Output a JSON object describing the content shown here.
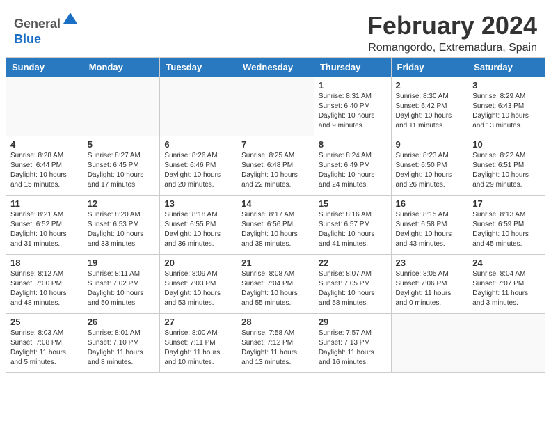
{
  "header": {
    "logo_general": "General",
    "logo_blue": "Blue",
    "month_title": "February 2024",
    "location": "Romangordo, Extremadura, Spain"
  },
  "weekdays": [
    "Sunday",
    "Monday",
    "Tuesday",
    "Wednesday",
    "Thursday",
    "Friday",
    "Saturday"
  ],
  "weeks": [
    [
      {
        "day": "",
        "info": ""
      },
      {
        "day": "",
        "info": ""
      },
      {
        "day": "",
        "info": ""
      },
      {
        "day": "",
        "info": ""
      },
      {
        "day": "1",
        "info": "Sunrise: 8:31 AM\nSunset: 6:40 PM\nDaylight: 10 hours\nand 9 minutes."
      },
      {
        "day": "2",
        "info": "Sunrise: 8:30 AM\nSunset: 6:42 PM\nDaylight: 10 hours\nand 11 minutes."
      },
      {
        "day": "3",
        "info": "Sunrise: 8:29 AM\nSunset: 6:43 PM\nDaylight: 10 hours\nand 13 minutes."
      }
    ],
    [
      {
        "day": "4",
        "info": "Sunrise: 8:28 AM\nSunset: 6:44 PM\nDaylight: 10 hours\nand 15 minutes."
      },
      {
        "day": "5",
        "info": "Sunrise: 8:27 AM\nSunset: 6:45 PM\nDaylight: 10 hours\nand 17 minutes."
      },
      {
        "day": "6",
        "info": "Sunrise: 8:26 AM\nSunset: 6:46 PM\nDaylight: 10 hours\nand 20 minutes."
      },
      {
        "day": "7",
        "info": "Sunrise: 8:25 AM\nSunset: 6:48 PM\nDaylight: 10 hours\nand 22 minutes."
      },
      {
        "day": "8",
        "info": "Sunrise: 8:24 AM\nSunset: 6:49 PM\nDaylight: 10 hours\nand 24 minutes."
      },
      {
        "day": "9",
        "info": "Sunrise: 8:23 AM\nSunset: 6:50 PM\nDaylight: 10 hours\nand 26 minutes."
      },
      {
        "day": "10",
        "info": "Sunrise: 8:22 AM\nSunset: 6:51 PM\nDaylight: 10 hours\nand 29 minutes."
      }
    ],
    [
      {
        "day": "11",
        "info": "Sunrise: 8:21 AM\nSunset: 6:52 PM\nDaylight: 10 hours\nand 31 minutes."
      },
      {
        "day": "12",
        "info": "Sunrise: 8:20 AM\nSunset: 6:53 PM\nDaylight: 10 hours\nand 33 minutes."
      },
      {
        "day": "13",
        "info": "Sunrise: 8:18 AM\nSunset: 6:55 PM\nDaylight: 10 hours\nand 36 minutes."
      },
      {
        "day": "14",
        "info": "Sunrise: 8:17 AM\nSunset: 6:56 PM\nDaylight: 10 hours\nand 38 minutes."
      },
      {
        "day": "15",
        "info": "Sunrise: 8:16 AM\nSunset: 6:57 PM\nDaylight: 10 hours\nand 41 minutes."
      },
      {
        "day": "16",
        "info": "Sunrise: 8:15 AM\nSunset: 6:58 PM\nDaylight: 10 hours\nand 43 minutes."
      },
      {
        "day": "17",
        "info": "Sunrise: 8:13 AM\nSunset: 6:59 PM\nDaylight: 10 hours\nand 45 minutes."
      }
    ],
    [
      {
        "day": "18",
        "info": "Sunrise: 8:12 AM\nSunset: 7:00 PM\nDaylight: 10 hours\nand 48 minutes."
      },
      {
        "day": "19",
        "info": "Sunrise: 8:11 AM\nSunset: 7:02 PM\nDaylight: 10 hours\nand 50 minutes."
      },
      {
        "day": "20",
        "info": "Sunrise: 8:09 AM\nSunset: 7:03 PM\nDaylight: 10 hours\nand 53 minutes."
      },
      {
        "day": "21",
        "info": "Sunrise: 8:08 AM\nSunset: 7:04 PM\nDaylight: 10 hours\nand 55 minutes."
      },
      {
        "day": "22",
        "info": "Sunrise: 8:07 AM\nSunset: 7:05 PM\nDaylight: 10 hours\nand 58 minutes."
      },
      {
        "day": "23",
        "info": "Sunrise: 8:05 AM\nSunset: 7:06 PM\nDaylight: 11 hours\nand 0 minutes."
      },
      {
        "day": "24",
        "info": "Sunrise: 8:04 AM\nSunset: 7:07 PM\nDaylight: 11 hours\nand 3 minutes."
      }
    ],
    [
      {
        "day": "25",
        "info": "Sunrise: 8:03 AM\nSunset: 7:08 PM\nDaylight: 11 hours\nand 5 minutes."
      },
      {
        "day": "26",
        "info": "Sunrise: 8:01 AM\nSunset: 7:10 PM\nDaylight: 11 hours\nand 8 minutes."
      },
      {
        "day": "27",
        "info": "Sunrise: 8:00 AM\nSunset: 7:11 PM\nDaylight: 11 hours\nand 10 minutes."
      },
      {
        "day": "28",
        "info": "Sunrise: 7:58 AM\nSunset: 7:12 PM\nDaylight: 11 hours\nand 13 minutes."
      },
      {
        "day": "29",
        "info": "Sunrise: 7:57 AM\nSunset: 7:13 PM\nDaylight: 11 hours\nand 16 minutes."
      },
      {
        "day": "",
        "info": ""
      },
      {
        "day": "",
        "info": ""
      }
    ]
  ]
}
